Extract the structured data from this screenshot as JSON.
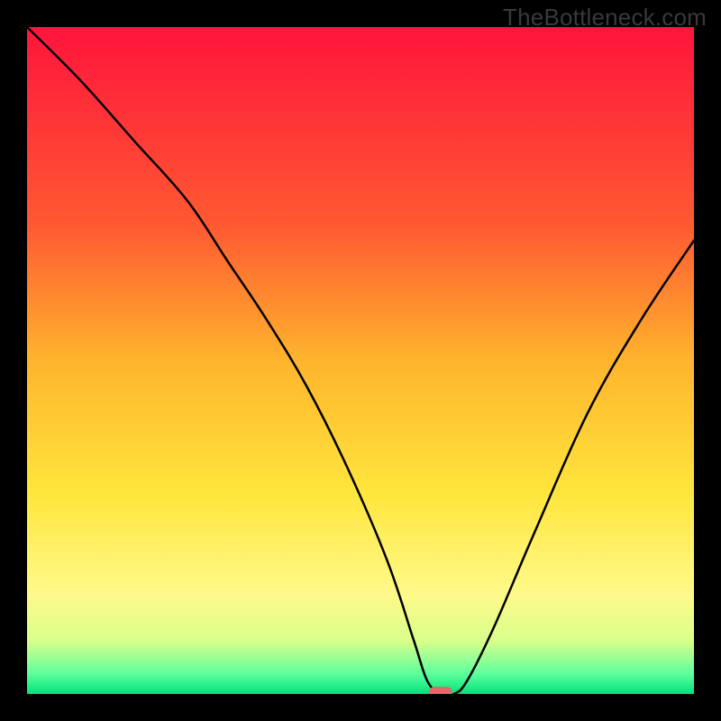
{
  "watermark": "TheBottleneck.com",
  "chart_data": {
    "type": "line",
    "title": "",
    "xlabel": "",
    "ylabel": "",
    "xlim": [
      0,
      100
    ],
    "ylim": [
      0,
      100
    ],
    "grid": false,
    "optimal_marker": {
      "x": 62,
      "y": 0
    },
    "gradient_stops": [
      {
        "offset": 0.0,
        "color": "#ff143c"
      },
      {
        "offset": 0.3,
        "color": "#ff5a32"
      },
      {
        "offset": 0.5,
        "color": "#ffb42d"
      },
      {
        "offset": 0.7,
        "color": "#ffe63c"
      },
      {
        "offset": 0.85,
        "color": "#fff98a"
      },
      {
        "offset": 0.92,
        "color": "#d9ff8a"
      },
      {
        "offset": 0.97,
        "color": "#5eff9d"
      },
      {
        "offset": 1.0,
        "color": "#00e27a"
      }
    ],
    "series": [
      {
        "name": "bottleneck-curve",
        "x": [
          0,
          8,
          16,
          24,
          30,
          36,
          42,
          48,
          54,
          58,
          60,
          62,
          64,
          66,
          70,
          76,
          84,
          92,
          100
        ],
        "y": [
          100,
          92,
          83,
          74,
          65,
          56,
          46,
          34,
          20,
          8,
          2,
          0,
          0,
          2,
          10,
          24,
          42,
          56,
          68
        ]
      }
    ]
  }
}
